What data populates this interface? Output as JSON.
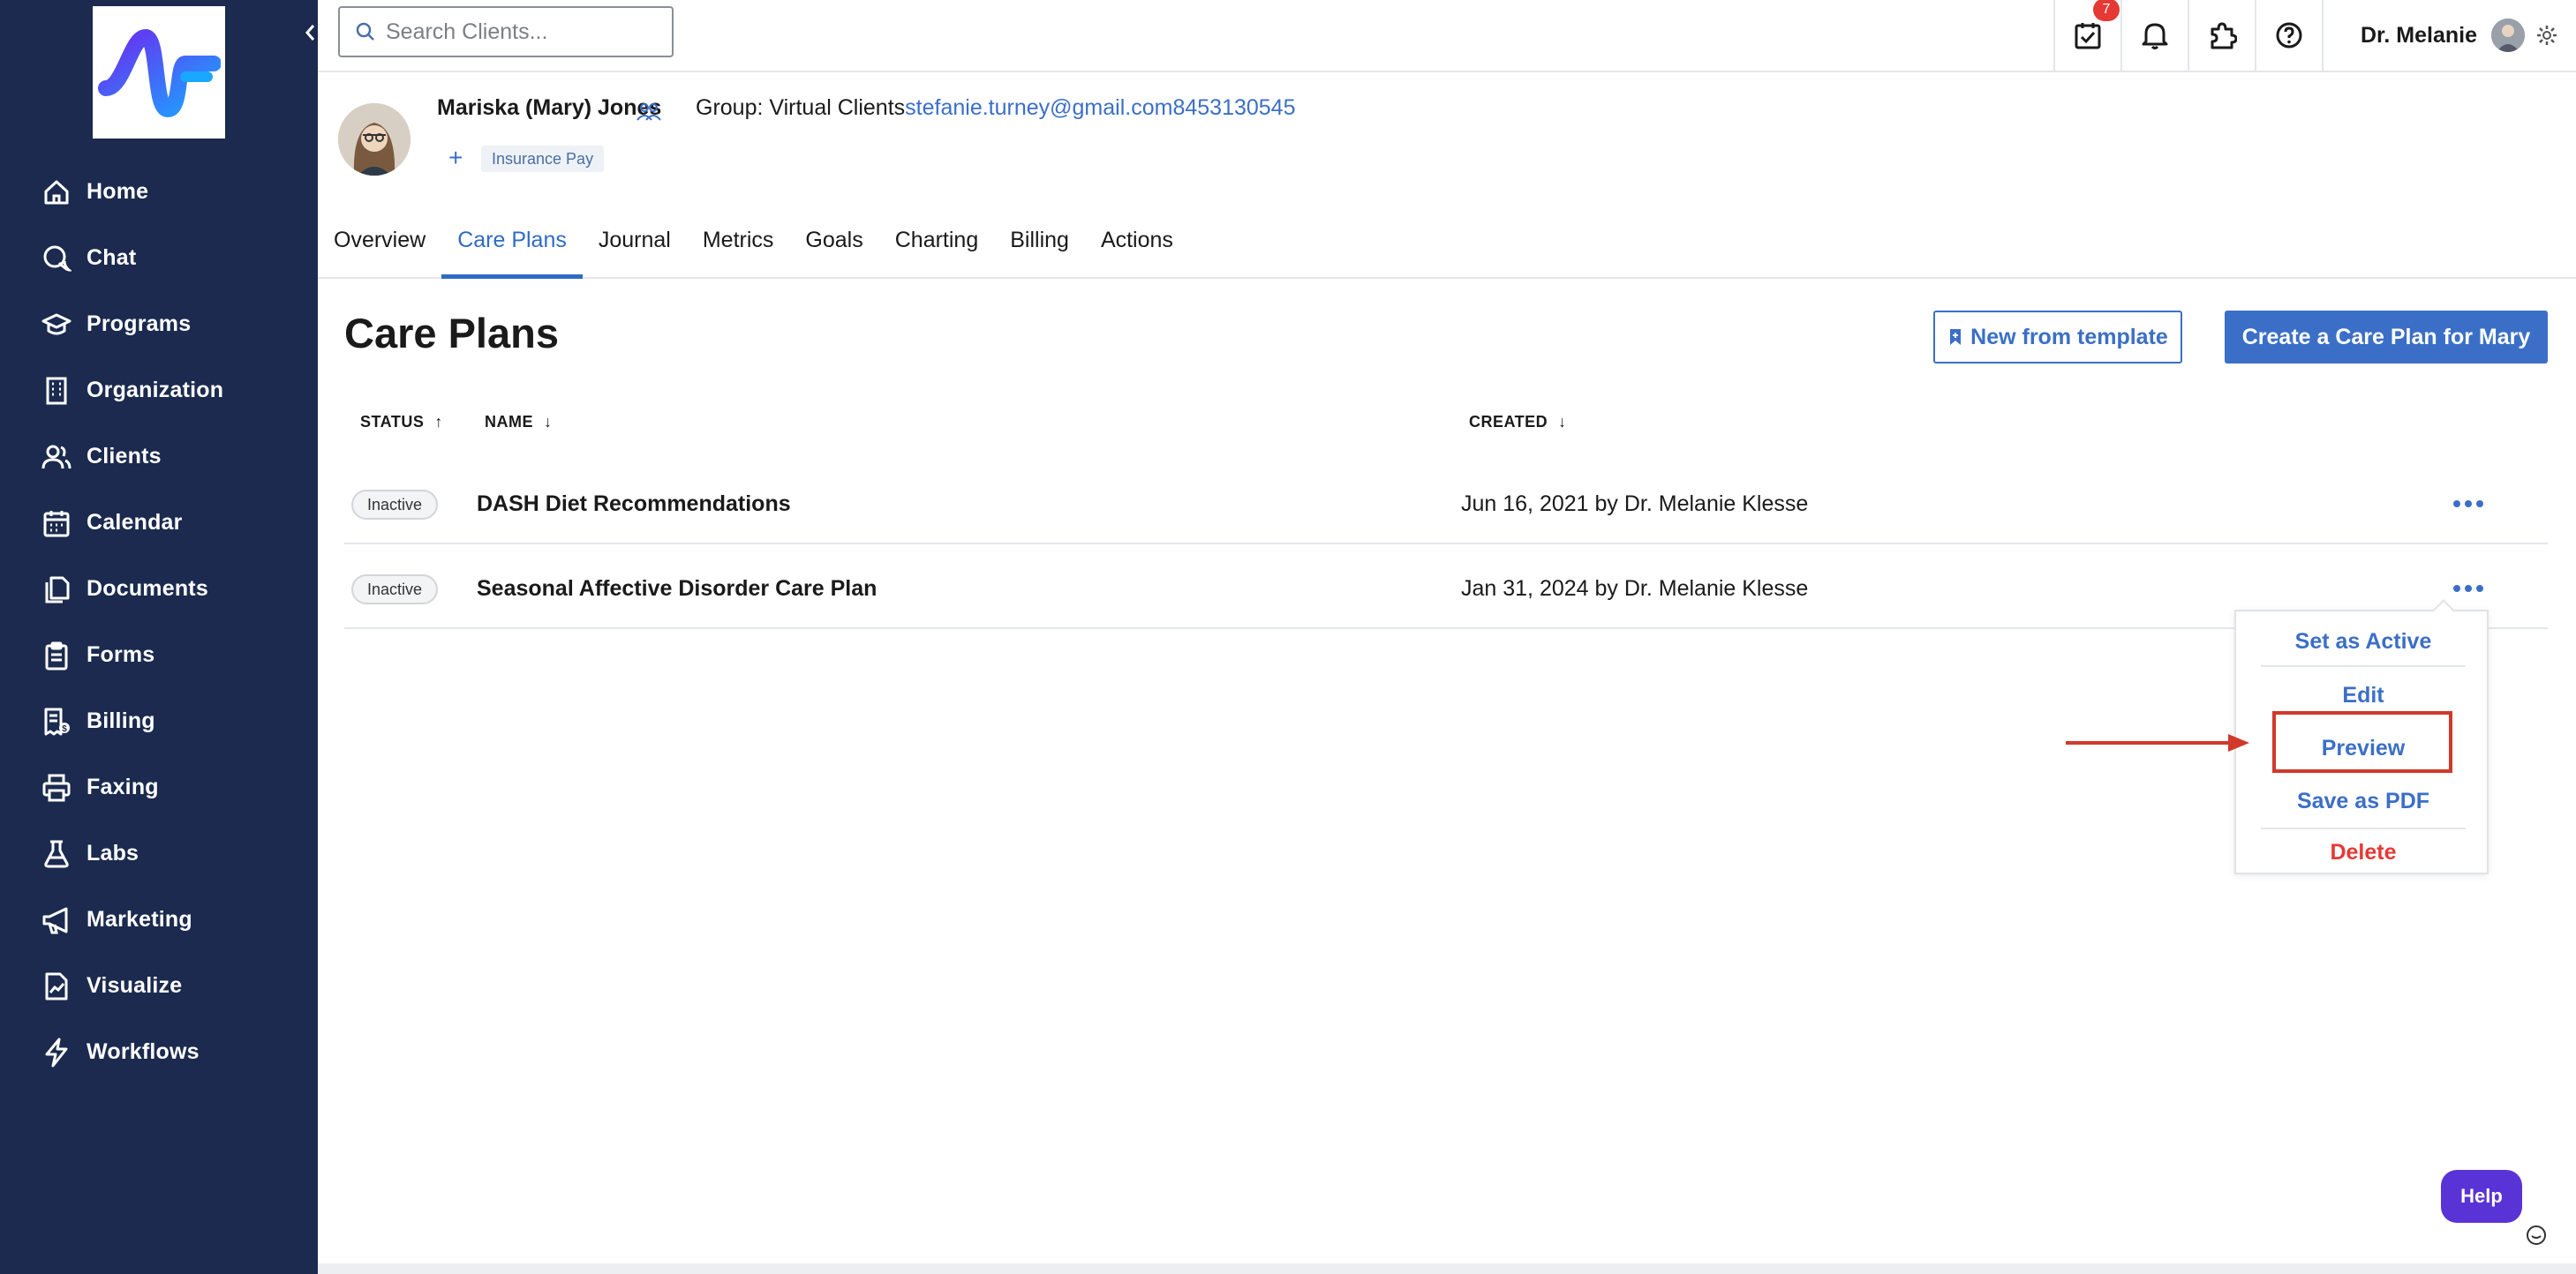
{
  "search": {
    "placeholder": "Search Clients..."
  },
  "sidebar": {
    "items": [
      {
        "label": "Home",
        "icon": "home-icon"
      },
      {
        "label": "Chat",
        "icon": "chat-icon"
      },
      {
        "label": "Programs",
        "icon": "graduation-cap-icon"
      },
      {
        "label": "Organization",
        "icon": "building-icon"
      },
      {
        "label": "Clients",
        "icon": "users-icon"
      },
      {
        "label": "Calendar",
        "icon": "calendar-icon"
      },
      {
        "label": "Documents",
        "icon": "documents-icon"
      },
      {
        "label": "Forms",
        "icon": "clipboard-icon"
      },
      {
        "label": "Billing",
        "icon": "billing-icon"
      },
      {
        "label": "Faxing",
        "icon": "printer-icon"
      },
      {
        "label": "Labs",
        "icon": "flask-icon"
      },
      {
        "label": "Marketing",
        "icon": "megaphone-icon"
      },
      {
        "label": "Visualize",
        "icon": "chart-document-icon"
      },
      {
        "label": "Workflows",
        "icon": "lightning-icon"
      }
    ]
  },
  "topbar": {
    "tasks_badge": "7",
    "user_name": "Dr. Melanie"
  },
  "client": {
    "name": "Mariska (Mary) Jones",
    "group_label": "Group: Virtual Clients",
    "email": "stefanie.turney@gmail.com",
    "phone": "8453130545",
    "add_tag": "+",
    "tag": "Insurance Pay"
  },
  "tabs": [
    "Overview",
    "Care Plans",
    "Journal",
    "Metrics",
    "Goals",
    "Charting",
    "Billing",
    "Actions"
  ],
  "active_tab": "Care Plans",
  "main": {
    "title": "Care Plans",
    "new_from_template": "New from template",
    "create_button": "Create a Care Plan for Mary"
  },
  "table": {
    "headers": {
      "status": "STATUS",
      "name": "NAME",
      "created": "CREATED"
    },
    "header_arrows": {
      "status": "↑",
      "name": "↓",
      "created": "↓"
    },
    "rows": [
      {
        "status": "Inactive",
        "name": "DASH Diet Recommendations",
        "created": "Jun 16, 2021 by Dr. Melanie Klesse"
      },
      {
        "status": "Inactive",
        "name": "Seasonal Affective Disorder Care Plan",
        "created": "Jan 31, 2024 by Dr. Melanie Klesse"
      }
    ]
  },
  "menu": {
    "set_active": "Set as Active",
    "edit": "Edit",
    "preview": "Preview",
    "save_pdf": "Save as PDF",
    "delete": "Delete"
  },
  "help": {
    "label": "Help"
  },
  "colors": {
    "sidebar_bg": "#1b2a4e",
    "accent": "#3b6fc7",
    "danger": "#e53935",
    "help_bg": "#5a33d6",
    "annotation": "#d0392b"
  }
}
